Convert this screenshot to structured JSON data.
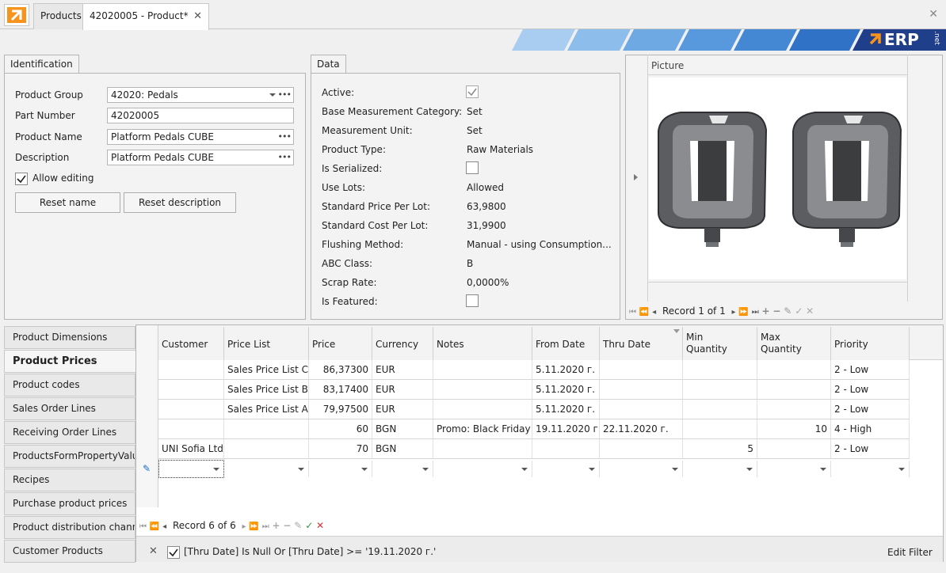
{
  "tabs": {
    "products": "Products",
    "product": "42020005 - Product*"
  },
  "banner": {
    "logo_text": "ERP",
    "logo_sub": ".net"
  },
  "identification": {
    "tab": "Identification",
    "product_group_label": "Product Group",
    "product_group_value": "42020: Pedals",
    "part_number_label": "Part Number",
    "part_number_value": "42020005",
    "product_name_label": "Product Name",
    "product_name_value": "Platform Pedals CUBE",
    "description_label": "Description",
    "description_value": "Platform Pedals CUBE",
    "allow_editing_label": "Allow editing",
    "reset_name_label": "Reset name",
    "reset_description_label": "Reset description"
  },
  "data": {
    "tab": "Data",
    "rows": [
      {
        "label": "Active:",
        "value": ""
      },
      {
        "label": "Base Measurement Category:",
        "value": "Set"
      },
      {
        "label": "Measurement Unit:",
        "value": "Set"
      },
      {
        "label": "Product Type:",
        "value": "Raw Materials"
      },
      {
        "label": "Is Serialized:",
        "value": ""
      },
      {
        "label": "Use Lots:",
        "value": "Allowed"
      },
      {
        "label": "Standard Price Per Lot:",
        "value": "63,9800"
      },
      {
        "label": "Standard Cost Per Lot:",
        "value": "31,9900"
      },
      {
        "label": "Flushing Method:",
        "value": "Manual - using Consumption..."
      },
      {
        "label": "ABC Class:",
        "value": "B"
      },
      {
        "label": "Scrap Rate:",
        "value": "0,0000%"
      },
      {
        "label": "Is Featured:",
        "value": ""
      }
    ]
  },
  "picture": {
    "header": "Picture",
    "record": "Record 1 of 1"
  },
  "nav_tabs": [
    "Product Dimensions",
    "Product Prices",
    "Product codes",
    "Sales Order Lines",
    "Receiving Order Lines",
    "ProductsFormPropertyValu",
    "Recipes",
    "Purchase product prices",
    "Product distribution channe",
    "Customer Products"
  ],
  "grid": {
    "columns": [
      "Customer",
      "Price List",
      "Price",
      "Currency",
      "Notes",
      "From Date",
      "Thru Date",
      "Min\nQuantity",
      "Max\nQuantity",
      "Priority"
    ],
    "rows": [
      [
        "",
        "Sales Price List C",
        "86,37300",
        "EUR",
        "",
        "5.11.2020 г.",
        "",
        "",
        "",
        "2 - Low"
      ],
      [
        "",
        "Sales Price List B",
        "83,17400",
        "EUR",
        "",
        "5.11.2020 г.",
        "",
        "",
        "",
        "2 - Low"
      ],
      [
        "",
        "Sales Price List A",
        "79,97500",
        "EUR",
        "",
        "5.11.2020 г.",
        "",
        "",
        "",
        "2 - Low"
      ],
      [
        "",
        "",
        "60",
        "BGN",
        "Promo: Black Friday",
        "19.11.2020 г.",
        "22.11.2020 г.",
        "",
        "10",
        "4 - High"
      ],
      [
        "UNI Sofia Ltd",
        "",
        "70",
        "BGN",
        "",
        "",
        "",
        "5",
        "",
        "2 - Low"
      ]
    ],
    "record": "Record 6 of 6",
    "filter_text": "[Thru Date] Is Null Or [Thru Date] >= '19.11.2020 г.'",
    "edit_filter": "Edit Filter"
  }
}
